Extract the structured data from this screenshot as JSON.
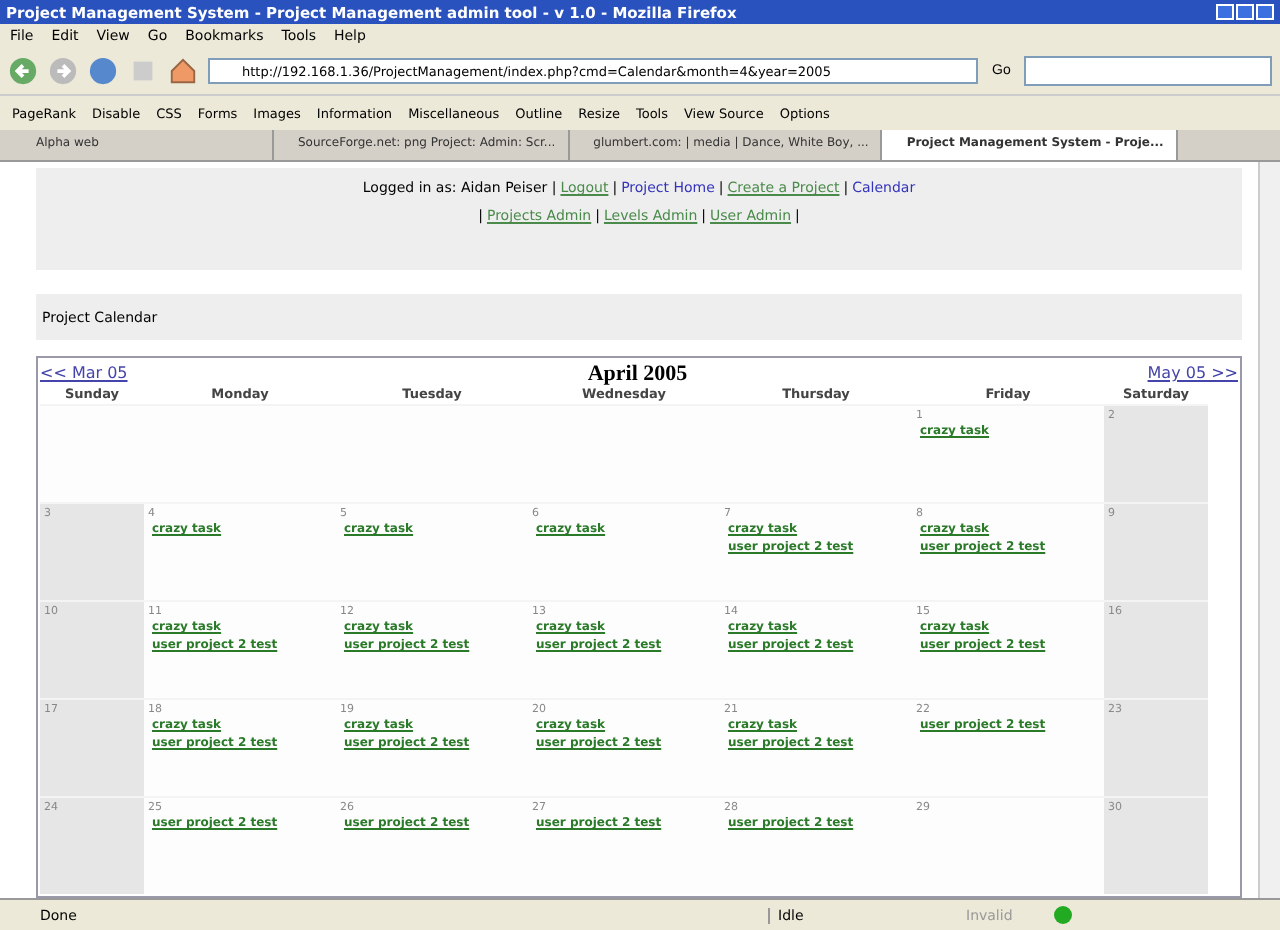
{
  "window": {
    "title": "Project Management System - Project Management admin tool - v 1.0 - Mozilla Firefox"
  },
  "menu": [
    "File",
    "Edit",
    "View",
    "Go",
    "Bookmarks",
    "Tools",
    "Help"
  ],
  "address": {
    "value": "http://192.168.1.36/ProjectManagement/index.php?cmd=Calendar&month=4&year=2005",
    "go": "Go"
  },
  "devbar": [
    "PageRank",
    "Disable",
    "CSS",
    "Forms",
    "Images",
    "Information",
    "Miscellaneous",
    "Outline",
    "Resize",
    "Tools",
    "View Source",
    "Options"
  ],
  "tabs": [
    {
      "label": "Alpha web",
      "selected": false
    },
    {
      "label": "SourceForge.net: png Project: Admin: Scr...",
      "selected": false
    },
    {
      "label": "glumbert.com: | media | Dance, White Boy, ...",
      "selected": false
    },
    {
      "label": "Project Management System - Proje...",
      "selected": true
    }
  ],
  "login_line": [
    {
      "kind": "text",
      "text": "Logged in as: Aidan Peiser |"
    },
    {
      "kind": "link",
      "text": "Logout",
      "visited": true
    },
    {
      "kind": "text",
      "text": "|"
    },
    {
      "kind": "link",
      "text": "Project Home",
      "visited": false
    },
    {
      "kind": "text",
      "text": "|"
    },
    {
      "kind": "link",
      "text": "Create a Project",
      "visited": true
    },
    {
      "kind": "text",
      "text": "|"
    },
    {
      "kind": "link",
      "text": "Calendar",
      "visited": false
    }
  ],
  "admin_line": [
    {
      "kind": "text",
      "text": "|"
    },
    {
      "kind": "link",
      "text": "Projects Admin",
      "visited": true
    },
    {
      "kind": "text",
      "text": "|"
    },
    {
      "kind": "link",
      "text": "Levels Admin",
      "visited": true
    },
    {
      "kind": "text",
      "text": "|"
    },
    {
      "kind": "link",
      "text": "User Admin",
      "visited": true
    },
    {
      "kind": "text",
      "text": "|"
    }
  ],
  "section_title": "Project Calendar",
  "calendar": {
    "prev": "<< Mar 05",
    "title": "April 2005",
    "next": "May 05 >>",
    "weekdays": [
      "Sunday",
      "Monday",
      "Tuesday",
      "Wednesday",
      "Thursday",
      "Friday",
      "Saturday"
    ],
    "weeks": [
      {
        "days": [
          {
            "kind": "blank"
          },
          {
            "kind": "blank"
          },
          {
            "kind": "blank"
          },
          {
            "kind": "blank"
          },
          {
            "kind": "blank"
          },
          {
            "kind": "date",
            "day": "1",
            "tasks": [
              "crazy task"
            ]
          },
          {
            "kind": "date",
            "day": "2"
          }
        ]
      },
      {
        "days": [
          {
            "kind": "date",
            "day": "3"
          },
          {
            "kind": "date",
            "day": "4",
            "tasks": [
              "crazy task"
            ]
          },
          {
            "kind": "date",
            "day": "5",
            "tasks": [
              "crazy task"
            ]
          },
          {
            "kind": "date",
            "day": "6",
            "tasks": [
              "crazy task"
            ]
          },
          {
            "kind": "date",
            "day": "7",
            "tasks": [
              "crazy task",
              "user project 2 test"
            ]
          },
          {
            "kind": "date",
            "day": "8",
            "tasks": [
              "crazy task",
              "user project 2 test"
            ]
          },
          {
            "kind": "date",
            "day": "9"
          }
        ]
      },
      {
        "days": [
          {
            "kind": "date",
            "day": "10"
          },
          {
            "day": "11",
            "tasks": [
              "crazy task",
              "user project 2 test"
            ]
          },
          {
            "day": "12",
            "tasks": [
              "crazy task",
              "user project 2 test"
            ]
          },
          {
            "day": "13",
            "tasks": [
              "crazy task",
              "user project 2 test"
            ]
          },
          {
            "day": "14",
            "tasks": [
              "crazy task",
              "user project 2 test"
            ]
          },
          {
            "day": "15",
            "tasks": [
              "crazy task",
              "user project 2 test"
            ]
          },
          {
            "day": "16"
          }
        ]
      },
      {
        "days": [
          {
            "day": "17"
          },
          {
            "day": "18",
            "tasks": [
              "crazy task",
              "user project 2 test"
            ]
          },
          {
            "day": "19",
            "tasks": [
              "crazy task",
              "user project 2 test"
            ]
          },
          {
            "day": "20",
            "tasks": [
              "crazy task",
              "user project 2 test"
            ]
          },
          {
            "day": "21",
            "tasks": [
              "crazy task",
              "user project 2 test"
            ]
          },
          {
            "day": "22",
            "tasks": [
              "user project 2 test"
            ]
          },
          {
            "day": "23"
          }
        ]
      },
      {
        "days": [
          {
            "day": "24"
          },
          {
            "day": "25",
            "tasks": [
              "user project 2 test"
            ]
          },
          {
            "day": "26",
            "tasks": [
              "user project 2 test"
            ]
          },
          {
            "day": "27",
            "tasks": [
              "user project 2 test"
            ]
          },
          {
            "day": "28",
            "tasks": [
              "user project 2 test"
            ]
          },
          {
            "day": "29"
          },
          {
            "day": "30"
          }
        ]
      }
    ]
  },
  "status_bar": {
    "text": "Done",
    "state": "Idle",
    "validator": "Invalid"
  }
}
